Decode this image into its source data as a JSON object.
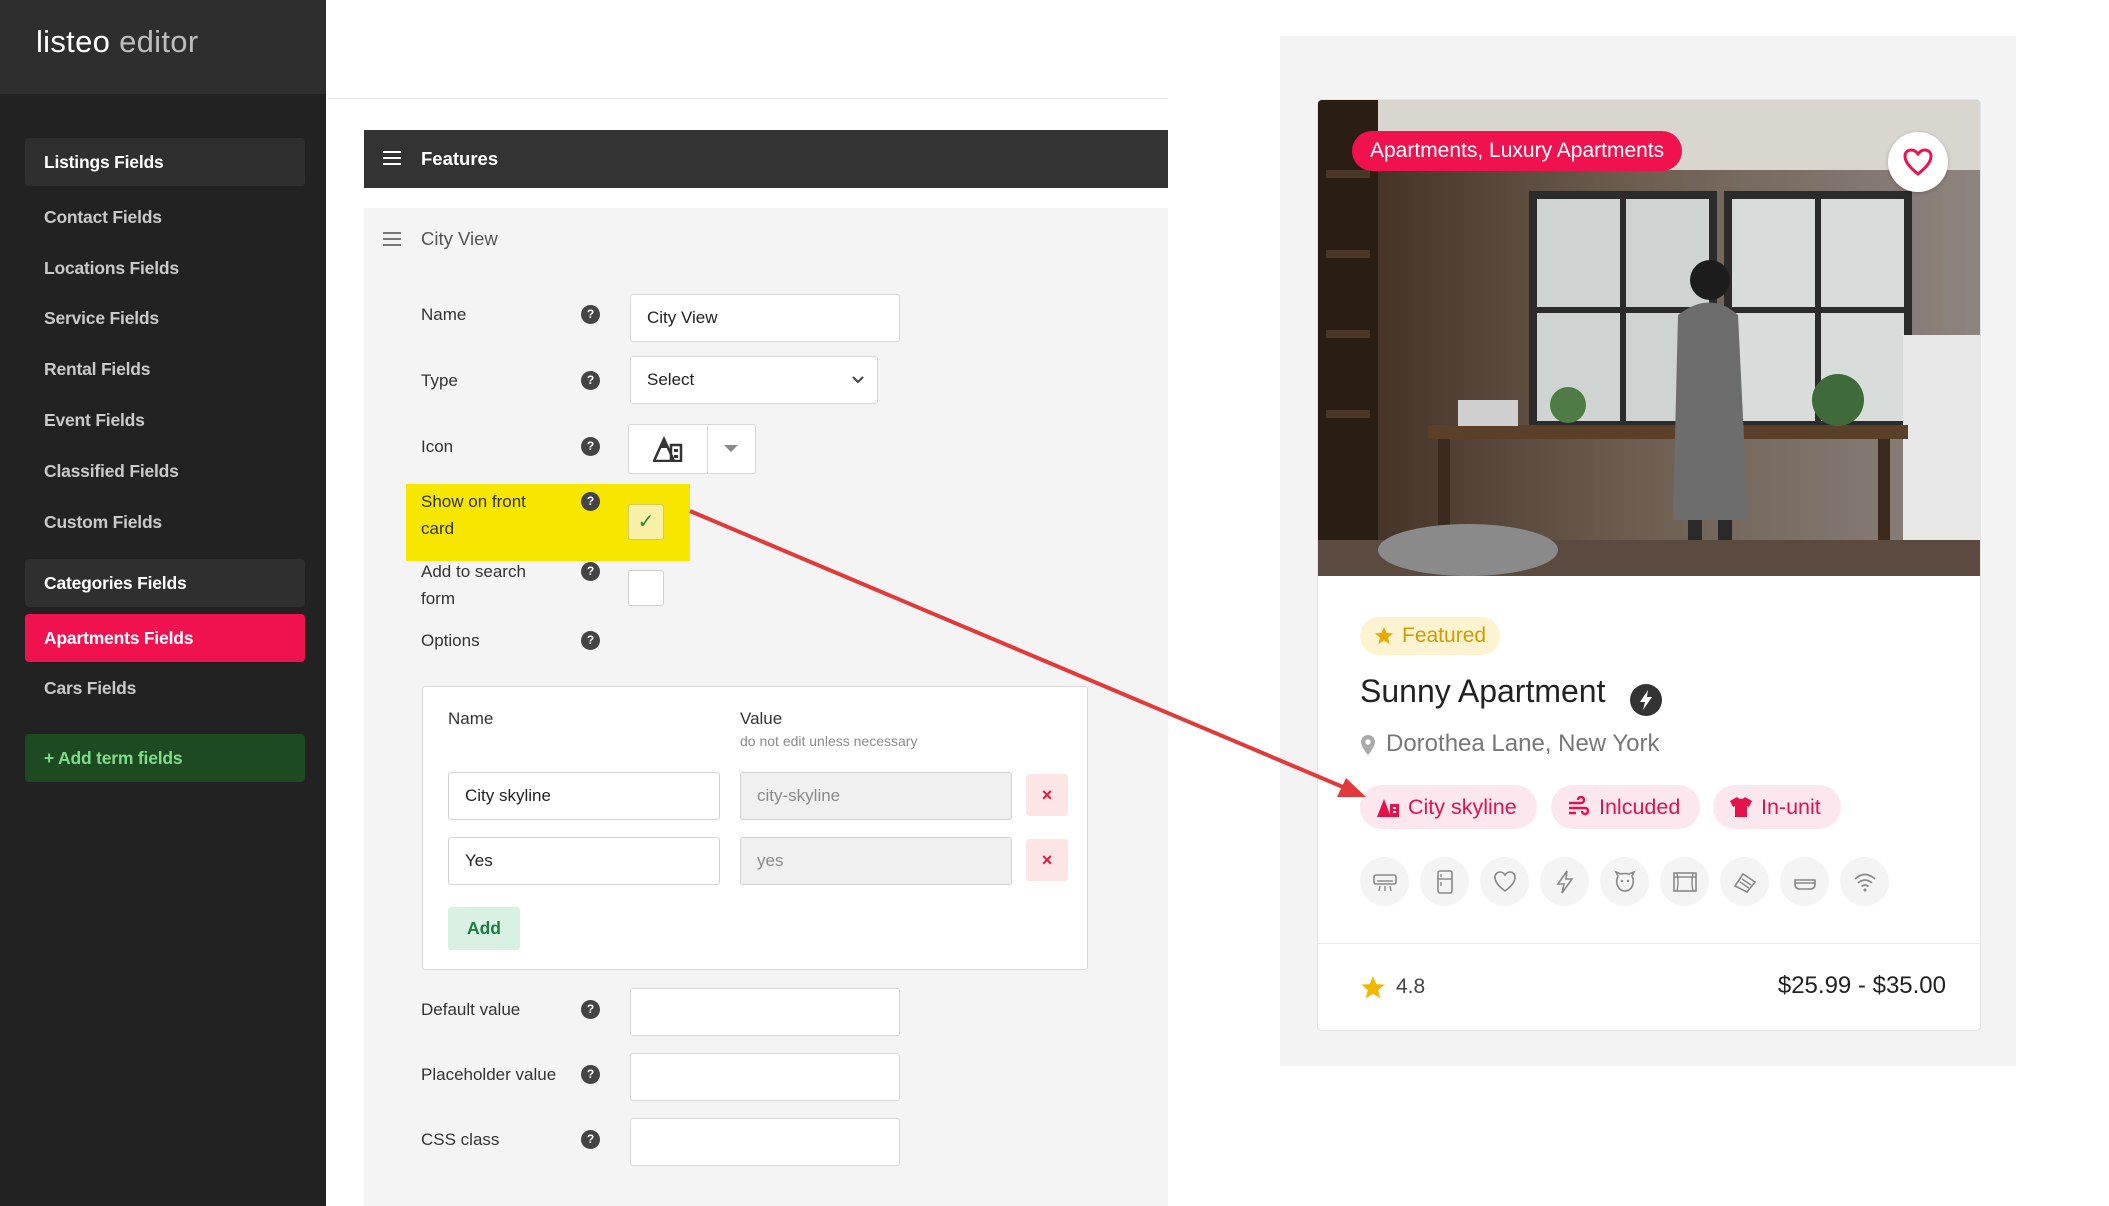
{
  "brand": {
    "name": "listeo",
    "suffix": "editor"
  },
  "sidebar": {
    "items": [
      {
        "label": "Listings Fields",
        "kind": "head"
      },
      {
        "label": "Contact Fields",
        "kind": "item"
      },
      {
        "label": "Locations Fields",
        "kind": "item"
      },
      {
        "label": "Service Fields",
        "kind": "item"
      },
      {
        "label": "Rental Fields",
        "kind": "item"
      },
      {
        "label": "Event Fields",
        "kind": "item"
      },
      {
        "label": "Classified Fields",
        "kind": "item"
      },
      {
        "label": "Custom Fields",
        "kind": "item"
      },
      {
        "label": "Categories Fields",
        "kind": "head"
      },
      {
        "label": "Apartments Fields",
        "kind": "active"
      },
      {
        "label": "Cars Fields",
        "kind": "item"
      },
      {
        "label": "+ Add term fields",
        "kind": "add"
      }
    ]
  },
  "editor": {
    "section_title": "Features",
    "field_title": "City View",
    "labels": {
      "name": "Name",
      "type": "Type",
      "icon": "Icon",
      "show_line1": "Show on front",
      "show_line2": "card",
      "search_line1": "Add to search",
      "search_line2": "form",
      "options": "Options",
      "default_value": "Default value",
      "placeholder_value": "Placeholder value",
      "css_class": "CSS class"
    },
    "help_glyph": "?",
    "name_value": "City View",
    "type_value": "Select",
    "show_on_front_card": true,
    "add_to_search_form": false,
    "default_value": "",
    "placeholder_value": "",
    "css_class": "",
    "options": {
      "col_name": "Name",
      "col_value": "Value",
      "col_value_hint": "do not edit unless necessary",
      "rows": [
        {
          "name": "City skyline",
          "value": "city-skyline"
        },
        {
          "name": "Yes",
          "value": "yes"
        }
      ],
      "delete_glyph": "×",
      "add_label": "Add"
    }
  },
  "preview": {
    "category_badge": "Apartments, Luxury Apartments",
    "featured_label": "Featured",
    "title": "Sunny Apartment",
    "location": "Dorothea Lane, New York",
    "tags": [
      {
        "label": "City skyline",
        "icon": "mountain-city-icon"
      },
      {
        "label": "Inlcuded",
        "icon": "wind-icon"
      },
      {
        "label": "In-unit",
        "icon": "shirt-icon"
      }
    ],
    "amenity_icons": [
      "air-conditioner-icon",
      "fridge-icon",
      "heart-icon",
      "bolt-icon",
      "pet-icon",
      "window-icon",
      "iron-icon",
      "bathtub-icon",
      "wifi-icon"
    ],
    "rating": "4.8",
    "price": "$25.99 - $35.00",
    "colors": {
      "accent": "#f0124e",
      "featured": "#d19b00",
      "highlight": "#f7e600",
      "arrow": "#e03a3a"
    }
  }
}
